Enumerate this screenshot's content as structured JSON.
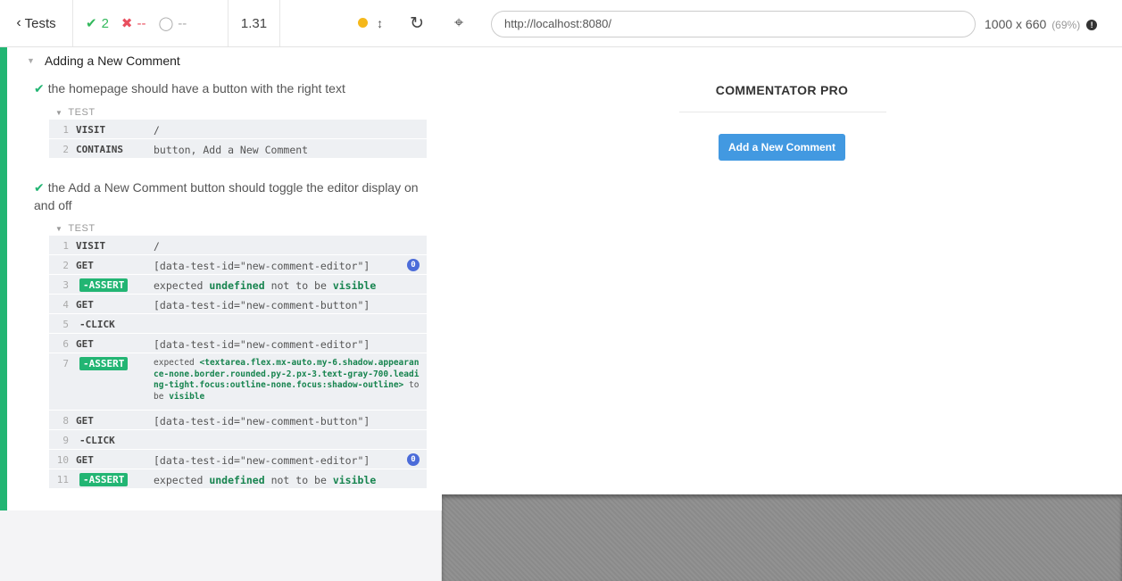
{
  "reporter": {
    "tests_button": "Tests",
    "passed": "2",
    "failed": "--",
    "pending": "--",
    "duration": "1.31",
    "suite_title": "Adding a New Comment",
    "tests": [
      {
        "title": "the homepage should have a button with the right text",
        "section_label": "TEST",
        "commands": [
          {
            "num": "1",
            "name": "VISIT",
            "message": "/"
          },
          {
            "num": "2",
            "name": "CONTAINS",
            "message": "button, Add a New Comment"
          }
        ]
      },
      {
        "title": "the Add a New Comment button should toggle the editor display on and off",
        "section_label": "TEST",
        "commands": [
          {
            "num": "1",
            "name": "VISIT",
            "message": "/"
          },
          {
            "num": "2",
            "name": "GET",
            "message": "[data-test-id=\"new-comment-editor\"]",
            "badge": "0"
          },
          {
            "num": "3",
            "name": "-ASSERT",
            "message_pre": "expected",
            "message_subject": "undefined",
            "message_mid": "not to be",
            "message_state": "visible"
          },
          {
            "num": "4",
            "name": "GET",
            "message": "[data-test-id=\"new-comment-button\"]"
          },
          {
            "num": "5",
            "name": "-CLICK",
            "message": ""
          },
          {
            "num": "6",
            "name": "GET",
            "message": "[data-test-id=\"new-comment-editor\"]"
          },
          {
            "num": "7",
            "name": "-ASSERT",
            "message_pre": "expected",
            "message_subject": "<textarea.flex.mx-auto.my-6.shadow.appearance-none.border.rounded.py-2.px-3.text-gray-700.leading-tight.focus:outline-none.focus:shadow-outline>",
            "message_mid": "to be",
            "message_state": "visible"
          },
          {
            "num": "8",
            "name": "GET",
            "message": "[data-test-id=\"new-comment-button\"]"
          },
          {
            "num": "9",
            "name": "-CLICK",
            "message": ""
          },
          {
            "num": "10",
            "name": "GET",
            "message": "[data-test-id=\"new-comment-editor\"]",
            "badge": "0"
          },
          {
            "num": "11",
            "name": "-ASSERT",
            "message_pre": "expected",
            "message_subject": "undefined",
            "message_mid": "not to be",
            "message_state": "visible"
          }
        ]
      }
    ]
  },
  "browser": {
    "url": "http://localhost:8080/",
    "viewport": "1000 x 660",
    "zoom": "(69%)"
  },
  "app": {
    "title": "COMMENTATOR PRO",
    "button_label": "Add a New Comment"
  },
  "icons": {
    "back": "chevron-left-icon",
    "pass": "check-icon",
    "fail": "x-icon",
    "pending": "circle-icon",
    "running": "dot-icon",
    "scroll": "up-down-arrows-icon",
    "reload": "reload-icon",
    "selector": "crosshair-icon",
    "info": "info-icon"
  },
  "colors": {
    "pass": "#22b573",
    "fail": "#e94f5f",
    "running": "#f5b81b",
    "app_button": "#4299e1",
    "badge": "#4c6cd9"
  }
}
